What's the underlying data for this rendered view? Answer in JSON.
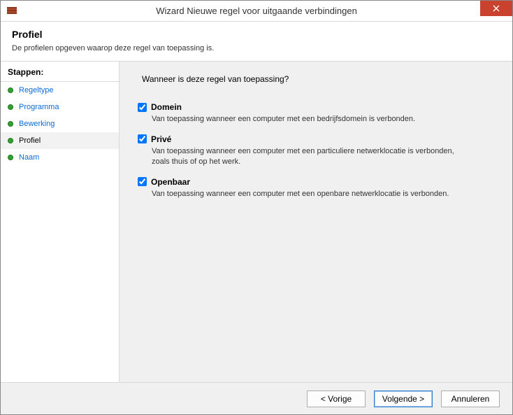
{
  "window": {
    "title": "Wizard Nieuwe regel voor uitgaande verbindingen"
  },
  "header": {
    "title": "Profiel",
    "subtitle": "De profielen opgeven waarop deze regel van toepassing is."
  },
  "sidebar": {
    "heading": "Stappen:",
    "items": [
      {
        "label": "Regeltype",
        "current": false
      },
      {
        "label": "Programma",
        "current": false
      },
      {
        "label": "Bewerking",
        "current": false
      },
      {
        "label": "Profiel",
        "current": true
      },
      {
        "label": "Naam",
        "current": false
      }
    ]
  },
  "main": {
    "question": "Wanneer is deze regel van toepassing?",
    "options": [
      {
        "label": "Domein",
        "checked": true,
        "desc": "Van toepassing wanneer een computer met een bedrijfsdomein is verbonden."
      },
      {
        "label": "Privé",
        "checked": true,
        "desc": "Van toepassing wanneer een computer met een particuliere netwerklocatie is verbonden, zoals thuis of op het werk."
      },
      {
        "label": "Openbaar",
        "checked": true,
        "desc": "Van toepassing wanneer een computer met een openbare netwerklocatie is verbonden."
      }
    ]
  },
  "footer": {
    "back": "< Vorige",
    "next": "Volgende >",
    "cancel": "Annuleren"
  }
}
